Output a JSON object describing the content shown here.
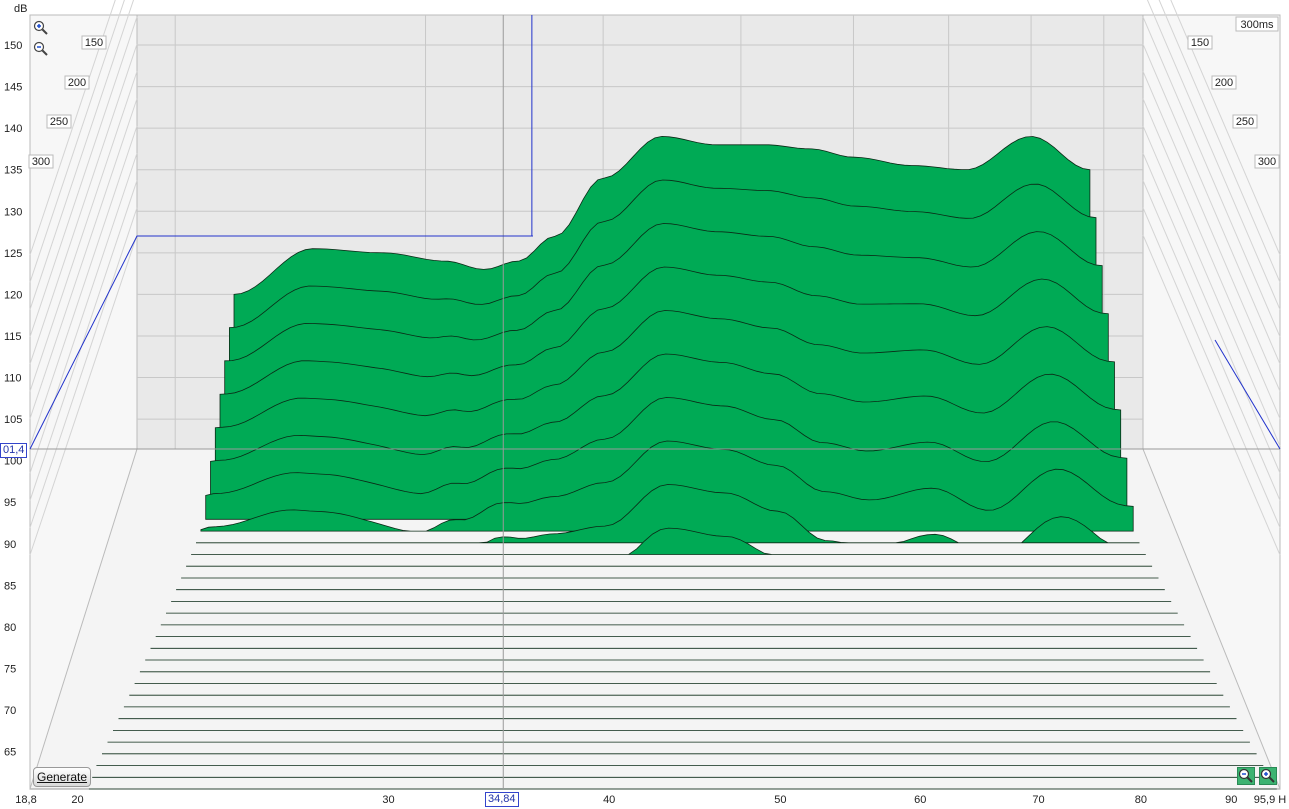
{
  "chart_data": {
    "type": "area",
    "subtype": "waterfall-csd",
    "y_unit_label": "dB",
    "y_ticks": [
      65,
      70,
      75,
      80,
      85,
      90,
      95,
      100,
      105,
      110,
      115,
      120,
      125,
      130,
      135,
      140,
      145,
      150
    ],
    "x_ticks": [
      {
        "v": 18.8,
        "label": "18,8"
      },
      {
        "v": 20,
        "label": "20"
      },
      {
        "v": 30,
        "label": "30"
      },
      {
        "v": 40,
        "label": "40"
      },
      {
        "v": 50,
        "label": "50"
      },
      {
        "v": 60,
        "label": "60"
      },
      {
        "v": 70,
        "label": "70"
      },
      {
        "v": 80,
        "label": "80"
      },
      {
        "v": 90,
        "label": "90"
      },
      {
        "v": 95.9,
        "label": "95,9 H"
      }
    ],
    "xlim": [
      18.8,
      95.9
    ],
    "ylim": [
      60,
      155
    ],
    "x_scale": "log",
    "time_labels_left": [
      "150",
      "200",
      "250",
      "300"
    ],
    "time_labels_right": [
      "150",
      "200",
      "250",
      "300"
    ],
    "time_max_label": "300ms",
    "cursor": {
      "x": 34.84,
      "x_label": "34,84",
      "y": 101.4,
      "y_label": "01,4"
    },
    "series": [
      {
        "freq": [
          22,
          25,
          28,
          31,
          33,
          34.84,
          37,
          40,
          44,
          48,
          52,
          56,
          60,
          66,
          72,
          80,
          88
        ],
        "values": [
          120,
          125.5,
          125,
          124,
          123,
          124,
          127,
          134,
          139,
          138,
          138,
          137.5,
          136.5,
          135.5,
          135,
          139,
          135
        ]
      },
      {
        "freq": [
          20,
          22,
          26,
          30,
          32,
          34,
          37,
          40,
          44,
          48,
          52,
          56,
          60,
          66,
          72,
          80,
          90
        ],
        "values": [
          96,
          103,
          101,
          97,
          101,
          105,
          103,
          99,
          104,
          103,
          99,
          93,
          92,
          96,
          91,
          97,
          92
        ]
      },
      {
        "freq": [
          20,
          23,
          26,
          30,
          33,
          35,
          38,
          42,
          46,
          50,
          53,
          56,
          58,
          60,
          62,
          66,
          70,
          75,
          80,
          85,
          90
        ],
        "values": [
          76,
          83,
          83,
          80,
          76,
          74,
          78,
          86,
          89,
          85,
          75,
          63,
          62,
          64,
          70,
          77,
          70,
          76,
          74,
          67,
          78
        ]
      }
    ],
    "slice_count": 30,
    "colors": {
      "fill": "#00aa55",
      "wall": "#ececec",
      "grid": "#c4c4c4",
      "cursor": "#2233cc",
      "cursor_grey": "#9a9a9a"
    }
  },
  "ui": {
    "generate_label": "Generate",
    "zoom_in_icon": "zoom-in-icon",
    "zoom_out_icon": "zoom-out-icon"
  }
}
